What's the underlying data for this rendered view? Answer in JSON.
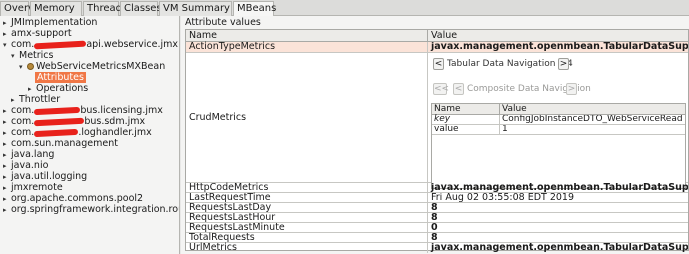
{
  "tabs": [
    "Overview",
    "Memory",
    "Threads",
    "Classes",
    "VM Summary",
    "MBeans"
  ],
  "tree": {
    "items": [
      {
        "label": "JMImplementation",
        "arrow": "▸"
      },
      {
        "label": "amx-support",
        "arrow": "▸"
      },
      {
        "label": "com.",
        "suffix": "api.webservice.jmx",
        "arrow": "▾"
      },
      {
        "label": "Metrics",
        "arrow": "▾"
      },
      {
        "label": "WebServiceMetricsMXBean",
        "arrow": "▾"
      },
      {
        "label": "Attributes",
        "arrow": ""
      },
      {
        "label": "Operations",
        "arrow": "▸"
      },
      {
        "label": "Throttler",
        "arrow": "▸"
      },
      {
        "label": "com.",
        "suffix": "bus.licensing.jmx",
        "arrow": "▸"
      },
      {
        "label": "com.",
        "suffix": "bus.sdm.jmx",
        "arrow": "▸"
      },
      {
        "label": "com.",
        "suffix": ".loghandler.jmx",
        "arrow": "▸"
      },
      {
        "label": "com.sun.management",
        "arrow": "▸"
      },
      {
        "label": "java.lang",
        "arrow": "▸"
      },
      {
        "label": "java.nio",
        "arrow": "▸"
      },
      {
        "label": "java.util.logging",
        "arrow": "▸"
      },
      {
        "label": "jmxremote",
        "arrow": "▸"
      },
      {
        "label": "org.apache.commons.pool2",
        "arrow": "▸"
      },
      {
        "label": "org.springframework.integration.router",
        "arrow": "▸"
      }
    ]
  },
  "panel": {
    "title": "Attribute values",
    "col_name": "Name",
    "col_value": "Value"
  },
  "attributes": [
    {
      "name": "ActionTypeMetrics",
      "value": "javax.management.openmbean.TabularDataSupport"
    },
    {
      "name": "CrudMetrics",
      "value": ""
    },
    {
      "name": "HttpCodeMetrics",
      "value": "javax.management.openmbean.TabularDataSupport"
    },
    {
      "name": "LastRequestTime",
      "value": "Fri Aug 02 03:55:08 EDT 2019"
    },
    {
      "name": "RequestsLastDay",
      "value": "8"
    },
    {
      "name": "RequestsLastHour",
      "value": "8"
    },
    {
      "name": "RequestsLastMinute",
      "value": "0"
    },
    {
      "name": "TotalRequests",
      "value": "8"
    },
    {
      "name": "UrlMetrics",
      "value": "javax.management.openmbean.TabularDataSupport"
    }
  ],
  "crud": {
    "tabular_nav": "Tabular Data Navigation 1/4",
    "composite_nav": "Composite Data Navigation",
    "prev": "<",
    "next": ">",
    "first": "<<",
    "sub_name": "Name",
    "sub_value": "Value",
    "rows": [
      {
        "k": "key",
        "v": "ConfigJobInstanceDTO_WebServiceRead"
      },
      {
        "k": "value",
        "v": "1"
      }
    ]
  }
}
